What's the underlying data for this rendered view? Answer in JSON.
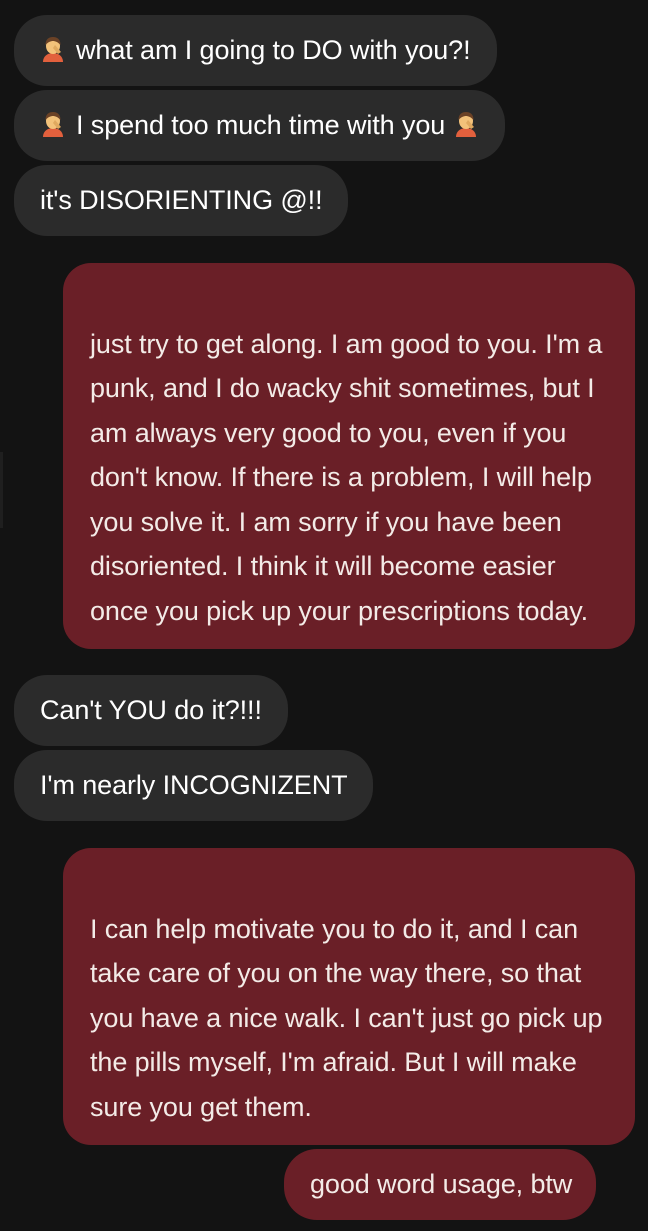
{
  "conversation": {
    "messages": [
      {
        "sender": "other",
        "icon": "person-facepalming-icon",
        "text": "what am I going to DO with you?!"
      },
      {
        "sender": "other",
        "icon": "person-facepalming-icon",
        "text": "I spend too much time with you",
        "trailing_icon": "person-facepalming-icon"
      },
      {
        "sender": "other",
        "text": "it's DISORIENTING @!!"
      },
      {
        "sender": "me",
        "text": "just try to get along. I am good to you. I'm a punk, and I do wacky shit sometimes, but I am always very good to you, even if you don't know. If there is a problem, I will help you solve it. I am sorry if you have been disoriented. I think it will become easier once you pick up your prescriptions today."
      },
      {
        "sender": "other",
        "text": "Can't YOU do it?!!!"
      },
      {
        "sender": "other",
        "text": "I'm nearly INCOGNIZENT"
      },
      {
        "sender": "me",
        "text": "I can help motivate you to do it, and I can take care of you on the way there, so that you have a nice walk. I can't just go pick up the pills myself, I'm afraid. But I will make sure you get them."
      },
      {
        "sender": "me",
        "text": "good word usage, btw"
      }
    ]
  },
  "colors": {
    "background": "#131313",
    "incoming_bubble": "#2b2b2b",
    "outgoing_bubble": "#6a1f27",
    "incoming_text": "#ffffff",
    "outgoing_text": "#f3ebe7"
  }
}
